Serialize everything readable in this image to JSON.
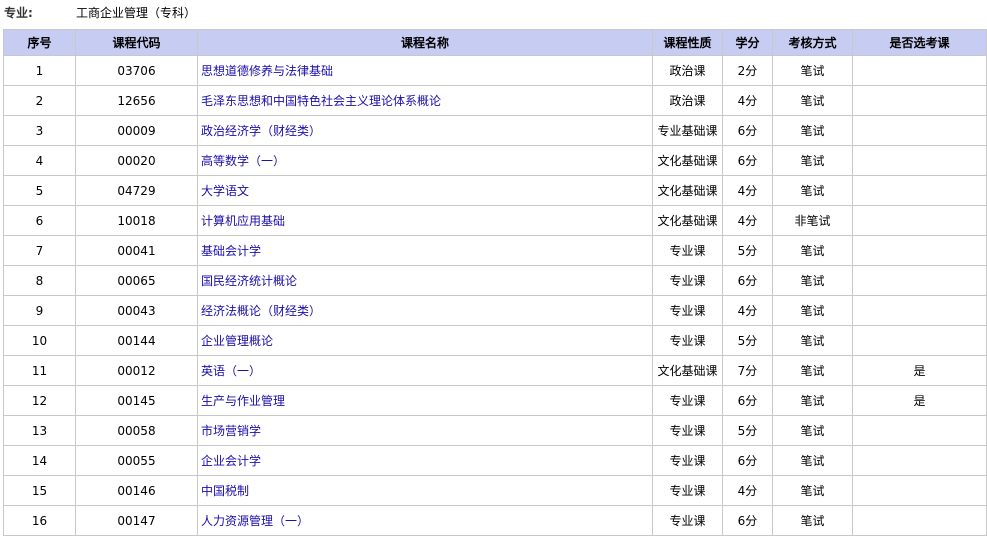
{
  "major": {
    "label": "专业:",
    "value": "工商企业管理（专科）"
  },
  "table": {
    "headers": [
      "序号",
      "课程代码",
      "课程名称",
      "课程性质",
      "学分",
      "考核方式",
      "是否选考课"
    ],
    "rows": [
      {
        "no": "1",
        "code": "03706",
        "name": "思想道德修养与法律基础",
        "type": "政治课",
        "credit": "2分",
        "exam": "笔试",
        "elective": ""
      },
      {
        "no": "2",
        "code": "12656",
        "name": "毛泽东思想和中国特色社会主义理论体系概论",
        "type": "政治课",
        "credit": "4分",
        "exam": "笔试",
        "elective": ""
      },
      {
        "no": "3",
        "code": "00009",
        "name": "政治经济学（财经类）",
        "type": "专业基础课",
        "credit": "6分",
        "exam": "笔试",
        "elective": ""
      },
      {
        "no": "4",
        "code": "00020",
        "name": "高等数学（一）",
        "type": "文化基础课",
        "credit": "6分",
        "exam": "笔试",
        "elective": ""
      },
      {
        "no": "5",
        "code": "04729",
        "name": "大学语文",
        "type": "文化基础课",
        "credit": "4分",
        "exam": "笔试",
        "elective": ""
      },
      {
        "no": "6",
        "code": "10018",
        "name": "计算机应用基础",
        "type": "文化基础课",
        "credit": "4分",
        "exam": "非笔试",
        "elective": ""
      },
      {
        "no": "7",
        "code": "00041",
        "name": "基础会计学",
        "type": "专业课",
        "credit": "5分",
        "exam": "笔试",
        "elective": ""
      },
      {
        "no": "8",
        "code": "00065",
        "name": "国民经济统计概论",
        "type": "专业课",
        "credit": "6分",
        "exam": "笔试",
        "elective": ""
      },
      {
        "no": "9",
        "code": "00043",
        "name": "经济法概论（财经类）",
        "type": "专业课",
        "credit": "4分",
        "exam": "笔试",
        "elective": ""
      },
      {
        "no": "10",
        "code": "00144",
        "name": "企业管理概论",
        "type": "专业课",
        "credit": "5分",
        "exam": "笔试",
        "elective": ""
      },
      {
        "no": "11",
        "code": "00012",
        "name": "英语（一）",
        "type": "文化基础课",
        "credit": "7分",
        "exam": "笔试",
        "elective": "是"
      },
      {
        "no": "12",
        "code": "00145",
        "name": "生产与作业管理",
        "type": "专业课",
        "credit": "6分",
        "exam": "笔试",
        "elective": "是"
      },
      {
        "no": "13",
        "code": "00058",
        "name": "市场营销学",
        "type": "专业课",
        "credit": "5分",
        "exam": "笔试",
        "elective": ""
      },
      {
        "no": "14",
        "code": "00055",
        "name": "企业会计学",
        "type": "专业课",
        "credit": "6分",
        "exam": "笔试",
        "elective": ""
      },
      {
        "no": "15",
        "code": "00146",
        "name": "中国税制",
        "type": "专业课",
        "credit": "4分",
        "exam": "笔试",
        "elective": ""
      },
      {
        "no": "16",
        "code": "00147",
        "name": "人力资源管理（一）",
        "type": "专业课",
        "credit": "6分",
        "exam": "笔试",
        "elective": ""
      }
    ]
  },
  "colors": {
    "header_bg": "#c7ccf3",
    "link": "#1a0dab",
    "border": "#c8c8c8"
  }
}
